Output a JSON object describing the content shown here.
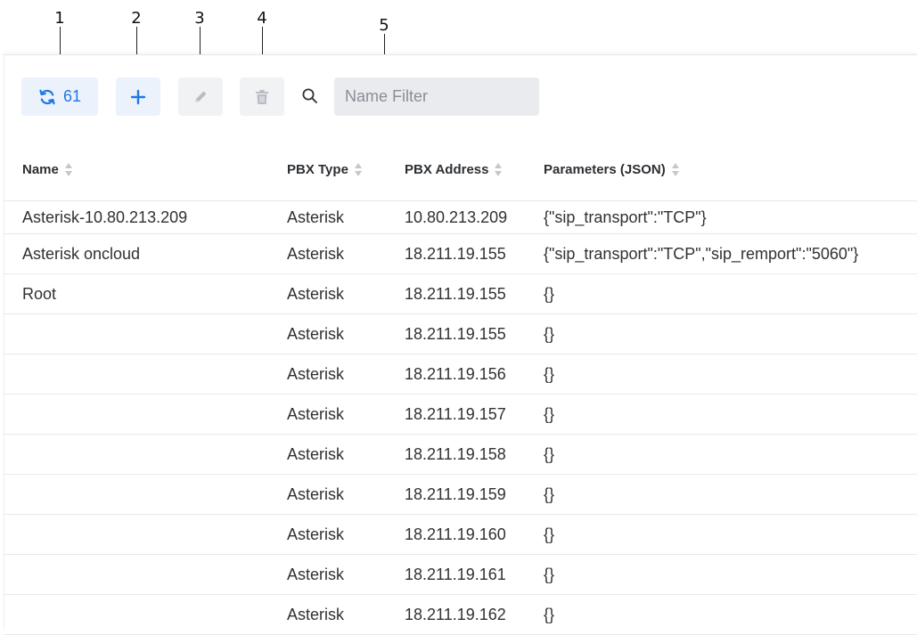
{
  "callouts": [
    "1",
    "2",
    "3",
    "4",
    "5"
  ],
  "toolbar": {
    "refresh_count": "61",
    "icons": {
      "refresh": "refresh-icon",
      "add": "plus-icon",
      "edit": "pencil-icon",
      "delete": "trash-icon",
      "search": "search-icon"
    },
    "accent": "#1f78e6"
  },
  "search": {
    "placeholder": "Name Filter",
    "value": ""
  },
  "table": {
    "columns": [
      "Name",
      "PBX Type",
      "PBX Address",
      "Parameters (JSON)"
    ],
    "rows": [
      [
        "Asterisk-10.80.213.209",
        "Asterisk",
        "10.80.213.209",
        "{\"sip_transport\":\"TCP\"}"
      ],
      [
        "Asterisk oncloud",
        "Asterisk",
        "18.211.19.155",
        "{\"sip_transport\":\"TCP\",\"sip_remport\":\"5060\"}"
      ],
      [
        "Root",
        "Asterisk",
        "18.211.19.155",
        "{}"
      ],
      [
        "",
        "Asterisk",
        "18.211.19.155",
        "{}"
      ],
      [
        "",
        "Asterisk",
        "18.211.19.156",
        "{}"
      ],
      [
        "",
        "Asterisk",
        "18.211.19.157",
        "{}"
      ],
      [
        "",
        "Asterisk",
        "18.211.19.158",
        "{}"
      ],
      [
        "",
        "Asterisk",
        "18.211.19.159",
        "{}"
      ],
      [
        "",
        "Asterisk",
        "18.211.19.160",
        "{}"
      ],
      [
        "",
        "Asterisk",
        "18.211.19.161",
        "{}"
      ],
      [
        "",
        "Asterisk",
        "18.211.19.162",
        "{}"
      ]
    ]
  }
}
